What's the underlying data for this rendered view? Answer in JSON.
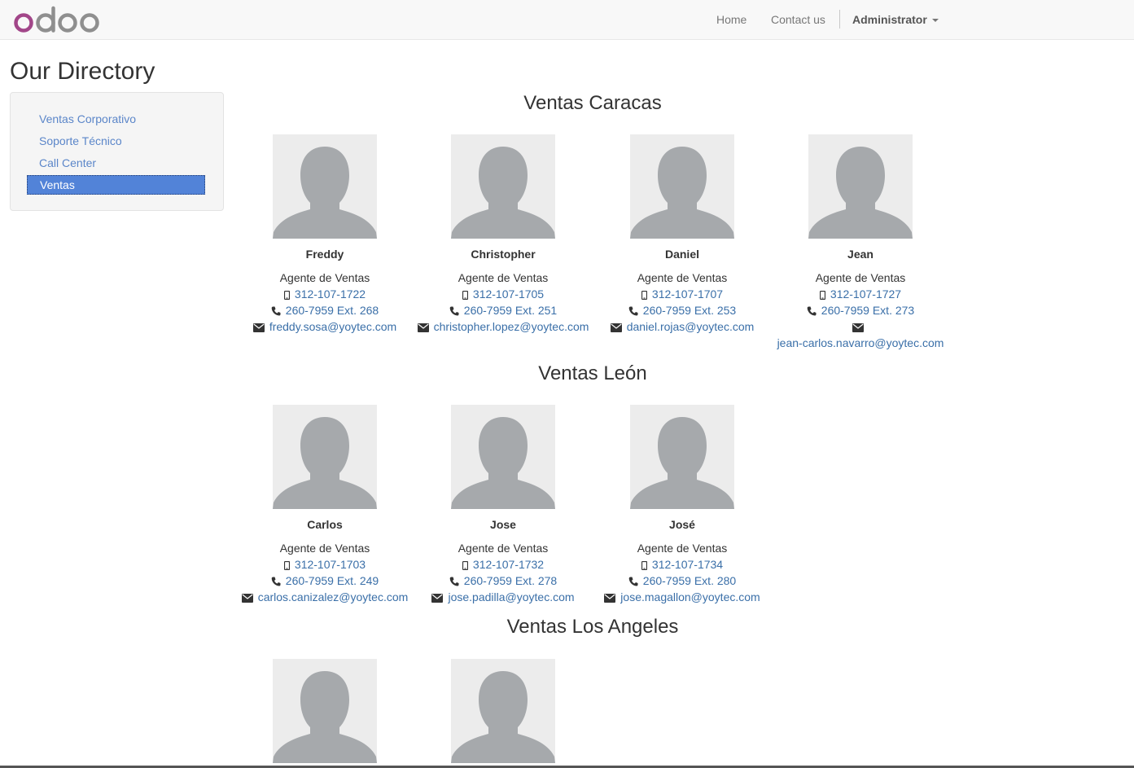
{
  "nav": {
    "home": "Home",
    "contact": "Contact us",
    "user": "Administrator"
  },
  "page_title": "Our Directory",
  "sidebar": {
    "items": [
      {
        "label": "Ventas Corporativo",
        "active": false
      },
      {
        "label": "Soporte Técnico",
        "active": false
      },
      {
        "label": "Call Center",
        "active": false
      },
      {
        "label": "Ventas",
        "active": true
      }
    ]
  },
  "sections": [
    {
      "title": "Ventas Caracas",
      "employees": [
        {
          "name": "Freddy",
          "job": "Agente de Ventas",
          "mobile": "312-107-1722",
          "phone": "260-7959 Ext. 268",
          "email": "freddy.sosa@yoytec.com"
        },
        {
          "name": "Christopher",
          "job": "Agente de Ventas",
          "mobile": "312-107-1705",
          "phone": "260-7959 Ext. 251",
          "email": "christopher.lopez@yoytec.com"
        },
        {
          "name": "Daniel",
          "job": "Agente de Ventas",
          "mobile": "312-107-1707",
          "phone": "260-7959 Ext. 253",
          "email": "daniel.rojas@yoytec.com"
        },
        {
          "name": "Jean",
          "job": "Agente de Ventas",
          "mobile": "312-107-1727",
          "phone": "260-7959 Ext. 273",
          "email": "jean-carlos.navarro@yoytec.com"
        }
      ]
    },
    {
      "title": "Ventas León",
      "employees": [
        {
          "name": "Carlos",
          "job": "Agente de Ventas",
          "mobile": "312-107-1703",
          "phone": "260-7959 Ext. 249",
          "email": "carlos.canizalez@yoytec.com"
        },
        {
          "name": "Jose",
          "job": "Agente de Ventas",
          "mobile": "312-107-1732",
          "phone": "260-7959 Ext. 278",
          "email": "jose.padilla@yoytec.com"
        },
        {
          "name": "José",
          "job": "Agente de Ventas",
          "mobile": "312-107-1734",
          "phone": "260-7959 Ext. 280",
          "email": "jose.magallon@yoytec.com"
        }
      ]
    },
    {
      "title": "Ventas Los Angeles",
      "employees": []
    }
  ],
  "icons": {
    "mobile": "mobile-icon",
    "phone": "phone-icon",
    "email": "envelope-icon",
    "avatar": "person-silhouette-icon"
  },
  "colors": {
    "link": "#3a6fa8",
    "sidebar_link": "#5b86c9",
    "active_bg": "#5283d8",
    "logo_o": "#a24689",
    "logo_text": "#8f8f8f"
  }
}
